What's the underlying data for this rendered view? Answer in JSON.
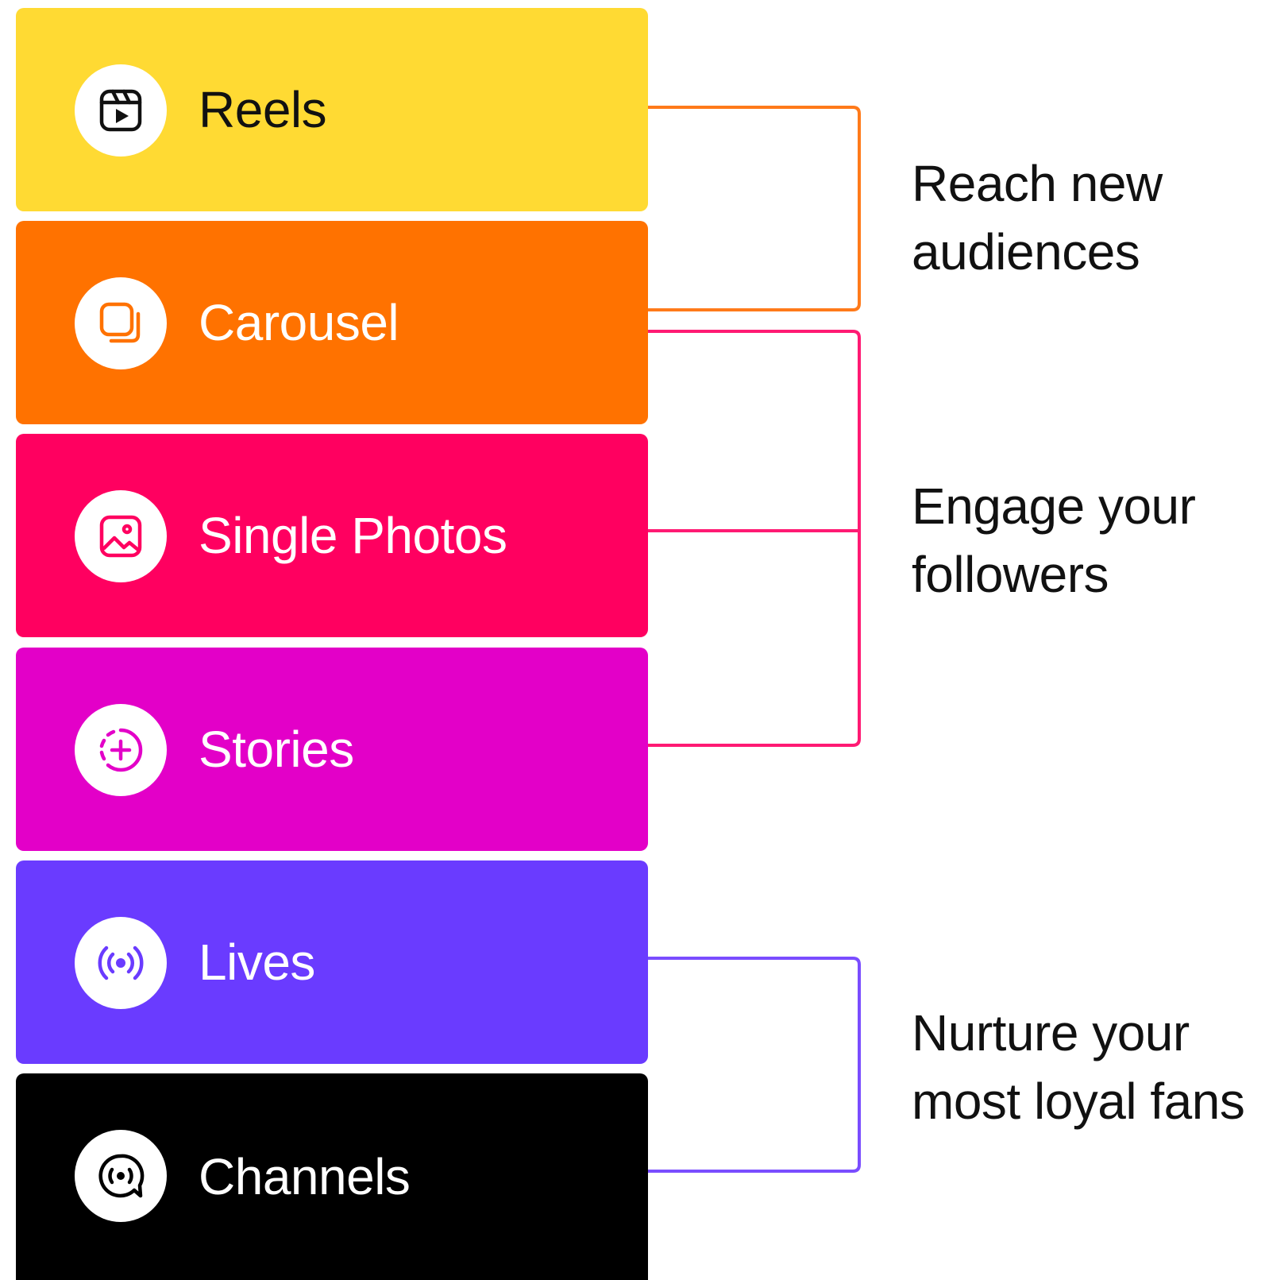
{
  "formats": [
    {
      "label": "Reels",
      "icon": "reels-icon",
      "bg": "#FFDA33",
      "text_color": "#111111",
      "icon_color": "#111111"
    },
    {
      "label": "Carousel",
      "icon": "carousel-icon",
      "bg": "#FF7200",
      "text_color": "#FFFFFF",
      "icon_color": "#FF7200"
    },
    {
      "label": "Single Photos",
      "icon": "photo-icon",
      "bg": "#FF0060",
      "text_color": "#FFFFFF",
      "icon_color": "#FF0060"
    },
    {
      "label": "Stories",
      "icon": "story-add-icon",
      "bg": "#E300C8",
      "text_color": "#FFFFFF",
      "icon_color": "#E300C8"
    },
    {
      "label": "Lives",
      "icon": "live-broadcast-icon",
      "bg": "#6A3BFF",
      "text_color": "#FFFFFF",
      "icon_color": "#6A3BFF"
    },
    {
      "label": "Channels",
      "icon": "channels-icon",
      "bg": "#000000",
      "text_color": "#FFFFFF",
      "icon_color": "#000000"
    }
  ],
  "outcomes": [
    {
      "line1": "Reach new",
      "line2": "audiences",
      "connector_color": "#FF7A1A"
    },
    {
      "line1": "Engage your",
      "line2": "followers",
      "connector_color": "#FF1A73"
    },
    {
      "line1": "Nurture your",
      "line2": "most loyal fans",
      "connector_color": "#7A4DFF"
    }
  ]
}
